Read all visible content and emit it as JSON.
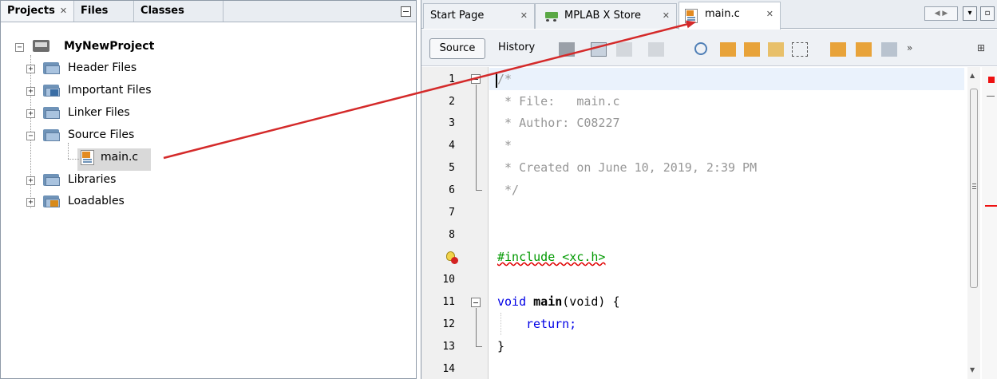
{
  "left_panel": {
    "tabs": [
      {
        "label": "Projects",
        "close": "✕"
      },
      {
        "label": "Files"
      },
      {
        "label": "Classes"
      }
    ],
    "tree": {
      "project": "MyNewProject",
      "folders": [
        {
          "label": "Header Files",
          "icon": "header-folder-icon"
        },
        {
          "label": "Important Files",
          "icon": "important-folder-icon"
        },
        {
          "label": "Linker Files",
          "icon": "linker-folder-icon"
        },
        {
          "label": "Source Files",
          "icon": "source-folder-icon"
        },
        {
          "label": "Libraries",
          "icon": "libraries-folder-icon"
        },
        {
          "label": "Loadables",
          "icon": "loadables-folder-icon"
        }
      ],
      "file": "main.c"
    }
  },
  "editor": {
    "tabs": [
      {
        "label": "Start Page",
        "close": "✕"
      },
      {
        "label": "MPLAB X Store",
        "close": "✕"
      },
      {
        "label": "main.c",
        "close": "✕"
      }
    ],
    "toolbar": {
      "source": "Source",
      "history": "History"
    },
    "lines": [
      {
        "n": "1",
        "text": "/*"
      },
      {
        "n": "2",
        "text": " * File:   main.c"
      },
      {
        "n": "3",
        "text": " * Author: C08227"
      },
      {
        "n": "4",
        "text": " *"
      },
      {
        "n": "5",
        "text": " * Created on June 10, 2019, 2:39 PM"
      },
      {
        "n": "6",
        "text": " */"
      },
      {
        "n": "7",
        "text": ""
      },
      {
        "n": "8",
        "text": ""
      },
      {
        "n": "9",
        "text": "#include <xc.h>"
      },
      {
        "n": "10",
        "text": ""
      },
      {
        "n": "11",
        "text": "void main(void) {"
      },
      {
        "n": "12",
        "text": "    return;"
      },
      {
        "n": "13",
        "text": "}"
      },
      {
        "n": "14",
        "text": ""
      }
    ],
    "code_parts": {
      "void": "void",
      "main": "main",
      "rest11": "(void) {",
      "ret": "return;",
      "close": "}"
    }
  },
  "colors": {
    "arrow": "#d42a2a",
    "keyword": "#0000e6",
    "comment": "#969696",
    "include": "#009900"
  }
}
